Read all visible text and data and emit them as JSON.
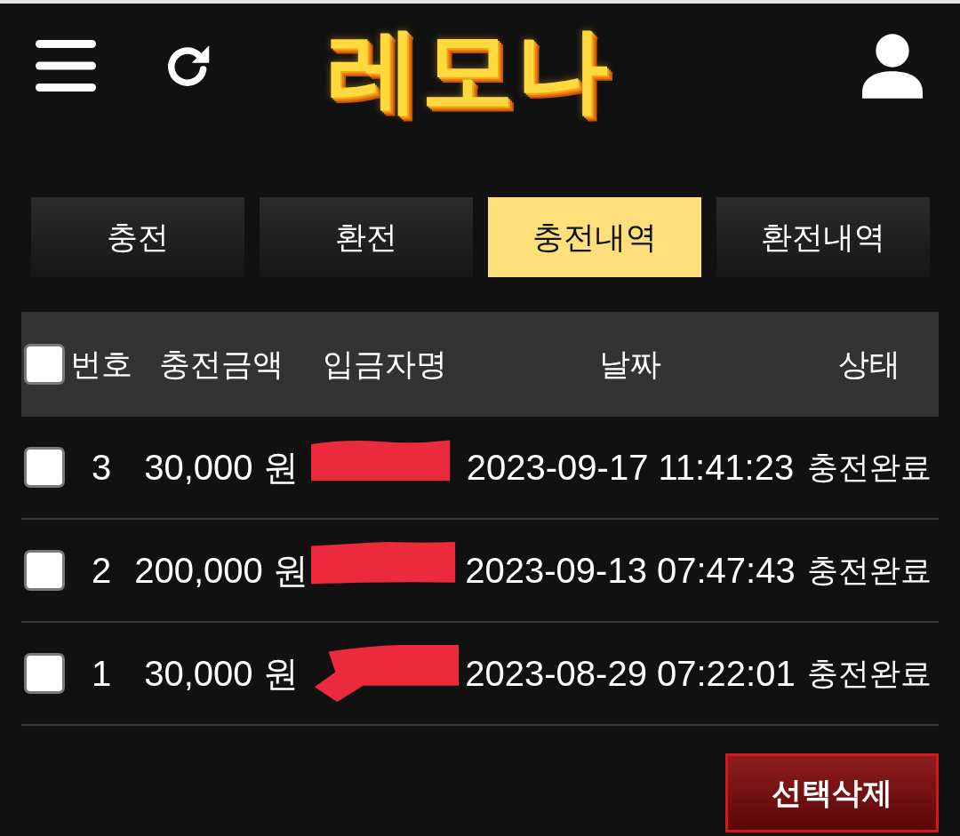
{
  "header": {
    "logo": "레모나"
  },
  "tabs": [
    {
      "label": "충전",
      "selected": false
    },
    {
      "label": "환전",
      "selected": false
    },
    {
      "label": "충전내역",
      "selected": true
    },
    {
      "label": "환전내역",
      "selected": false
    }
  ],
  "table": {
    "header_checkbox": {
      "checked": false
    },
    "columns": [
      "번호",
      "충전금액",
      "입금자명",
      "날짜",
      "상태"
    ],
    "rows": [
      {
        "checked": false,
        "number": "3",
        "amount": "30,000 원",
        "depositor_redacted": true,
        "date": "2023-09-17 11:41:23",
        "status": "충전완료"
      },
      {
        "checked": false,
        "number": "2",
        "amount": "200,000 원",
        "depositor_redacted": true,
        "date": "2023-09-13 07:47:43",
        "status": "충전완료"
      },
      {
        "checked": false,
        "number": "1",
        "amount": "30,000 원",
        "depositor_redacted": true,
        "date": "2023-08-29 07:22:01",
        "status": "충전완료"
      }
    ]
  },
  "delete_button": "선택삭제"
}
